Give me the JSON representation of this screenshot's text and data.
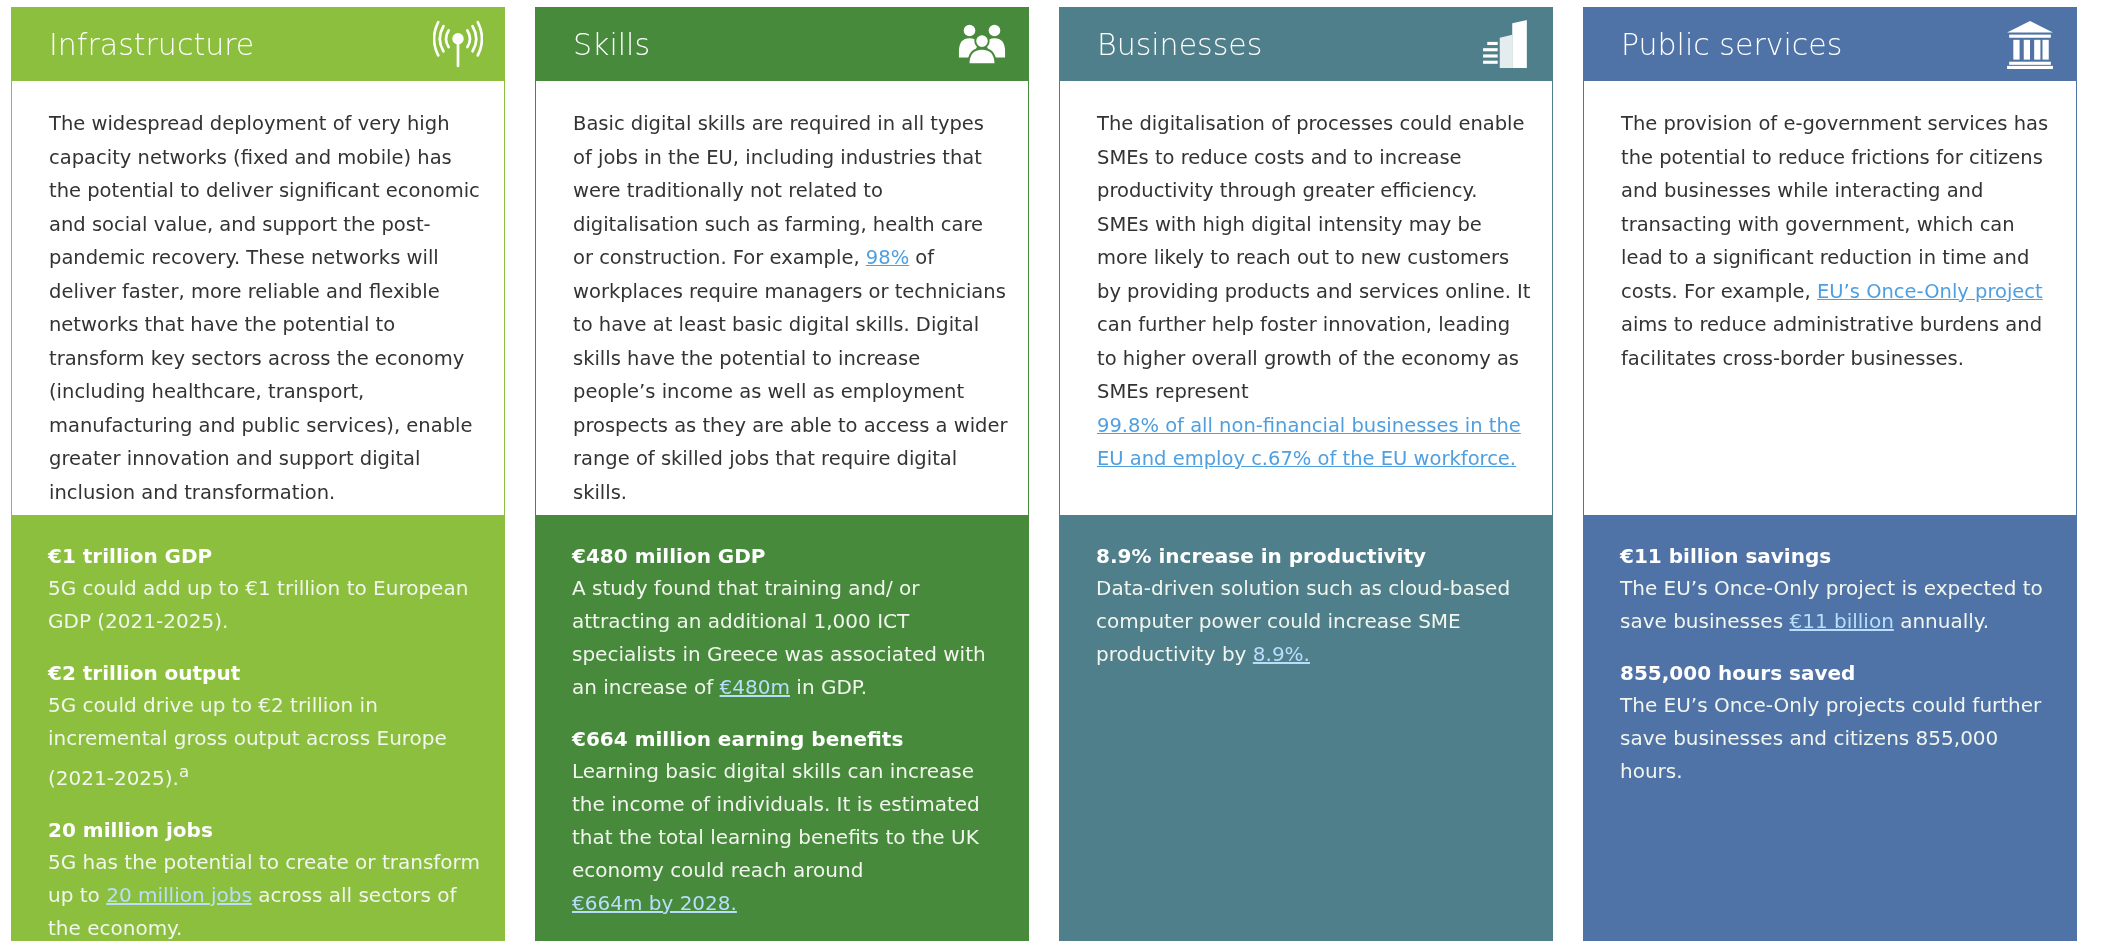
{
  "cards": [
    {
      "title": "Infrastructure",
      "kind": "antenna",
      "color": "#8bbf3d",
      "body": [
        {
          "text": "The widespread deployment of very high capacity networks (fixed and mobile) has the potential to deliver significant economic and social value, and support the post-pandemic recovery. These networks will deliver faster, more reliable and flexible networks that have the potential to transform key sectors across the economy (including healthcare, transport, manufacturing and public services), enable greater innovation and support digital inclusion and transformation.",
          "link": false
        }
      ],
      "stats": [
        {
          "heading": "€1 trillion GDP",
          "text": [
            {
              "text": "5G could add up to €1 trillion to European GDP (2021-2025).",
              "link": false
            }
          ]
        },
        {
          "heading": "€2 trillion output",
          "text": [
            {
              "text": "5G could drive up to €2 trillion in incremental gross output across Europe (2021-2025).$^{a}$",
              "link": false
            }
          ]
        },
        {
          "heading": "20 million jobs",
          "text": [
            {
              "text": "5G has the potential to create or transform up to ",
              "link": false
            },
            {
              "text": "20 million jobs",
              "link": true
            },
            {
              "text": " across all sectors of the economy.",
              "link": false
            }
          ]
        }
      ]
    },
    {
      "title": "Skills",
      "kind": "people",
      "color": "#478a3c",
      "body": [
        {
          "text": "Basic digital skills are required in all types of jobs in the EU, including industries that were traditionally not related to digitalisation such as farming, health care or construction. For example, ",
          "link": false
        },
        {
          "text": "98%",
          "link": true
        },
        {
          "text": " of workplaces require managers or technicians to have at least basic digital skills. Digital skills have the potential to increase people’s income as well as employment prospects as they are able to access a wider range of skilled jobs that require digital skills.",
          "link": false
        }
      ],
      "stats": [
        {
          "heading": "€480 million GDP",
          "text": [
            {
              "text": "A study found that training and/ or attracting an additional 1,000 ICT specialists in Greece was associated with an increase of ",
              "link": false
            },
            {
              "text": "€480m",
              "link": true
            },
            {
              "text": " in GDP.",
              "link": false
            }
          ]
        },
        {
          "heading": "€664 million earning benefits",
          "text": [
            {
              "text": "Learning basic digital skills can increase the income of individuals. It is estimated that the total learning benefits to the UK economy could reach around ",
              "link": false
            },
            {
              "text": "€664m by 2028.",
              "link": true
            }
          ]
        }
      ]
    },
    {
      "title": "Businesses",
      "kind": "building",
      "color": "#4f7f8a",
      "body": [
        {
          "text": "The digitalisation of processes could enable SMEs to reduce costs and to increase productivity through greater efficiency. SMEs with high digital intensity may be more likely to reach out to new customers by providing products and services online. It can further help foster innovation, leading to higher overall growth of the economy as SMEs represent ",
          "link": false
        },
        {
          "text": "99.8% of all non-financial businesses in the EU and employ c.67% of the EU workforce.",
          "link": true
        }
      ],
      "stats": [
        {
          "heading": "8.9% increase in productivity",
          "text": [
            {
              "text": "Data-driven solution such as cloud-based computer power could increase SME productivity by ",
              "link": false
            },
            {
              "text": "8.9%.",
              "link": true
            }
          ]
        }
      ]
    },
    {
      "title": "Public services",
      "kind": "columns",
      "color": "#4f72a7",
      "body": [
        {
          "text": "The provision of e-government services has the potential to reduce frictions for citizens and businesses while interacting and transacting with government, which can lead to a significant reduction in time and costs. For example, ",
          "link": false
        },
        {
          "text": "EU’s Once-Only project",
          "link": true
        },
        {
          "text": " aims to reduce administrative burdens and facilitates cross-border businesses.",
          "link": false
        }
      ],
      "stats": [
        {
          "heading": "€11 billion savings",
          "text": [
            {
              "text": "The EU’s Once-Only project is expected to save businesses ",
              "link": false
            },
            {
              "text": "€11 billion",
              "link": true
            },
            {
              "text": " annually.",
              "link": false
            }
          ]
        },
        {
          "heading": "855,000 hours saved",
          "text": [
            {
              "text": "The EU’s Once-Only projects could further save businesses and citizens 855,000 hours.",
              "link": false
            }
          ]
        }
      ]
    }
  ]
}
